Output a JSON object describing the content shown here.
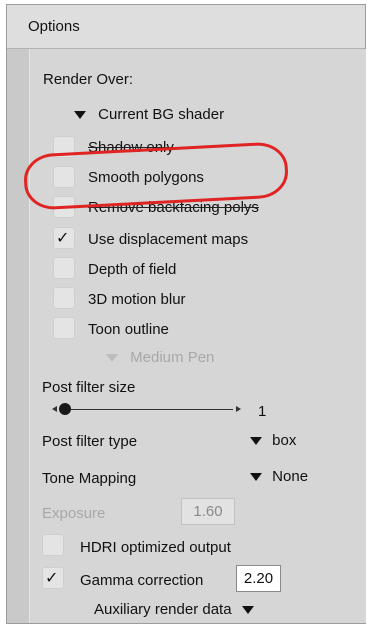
{
  "panel": {
    "title": "Options",
    "render_over": {
      "label": "Render Over:",
      "value": "Current BG shader"
    },
    "checkboxes": [
      {
        "label": "Shadow only",
        "checked": false
      },
      {
        "label": "Smooth polygons",
        "checked": false
      },
      {
        "label": "Remove backfacing polys",
        "checked": false
      },
      {
        "label": "Use displacement maps",
        "checked": true
      },
      {
        "label": "Depth of field",
        "checked": false
      },
      {
        "label": "3D motion blur",
        "checked": false
      },
      {
        "label": "Toon outline",
        "checked": false
      }
    ],
    "toon_pen": "Medium Pen",
    "post_filter_size": {
      "label": "Post filter size",
      "value": "1"
    },
    "post_filter_type": {
      "label": "Post filter type",
      "value": "box"
    },
    "tone_mapping": {
      "label": "Tone Mapping",
      "value": "None"
    },
    "exposure": {
      "label": "Exposure",
      "value": "1.60"
    },
    "hdri": {
      "label": "HDRI optimized output",
      "checked": false
    },
    "gamma": {
      "label": "Gamma correction",
      "checked": true,
      "value": "2.20"
    },
    "auxiliary": {
      "label": "Auxiliary render data"
    },
    "check_glyph": "✓"
  },
  "annotation": {
    "color": "#e02323"
  }
}
